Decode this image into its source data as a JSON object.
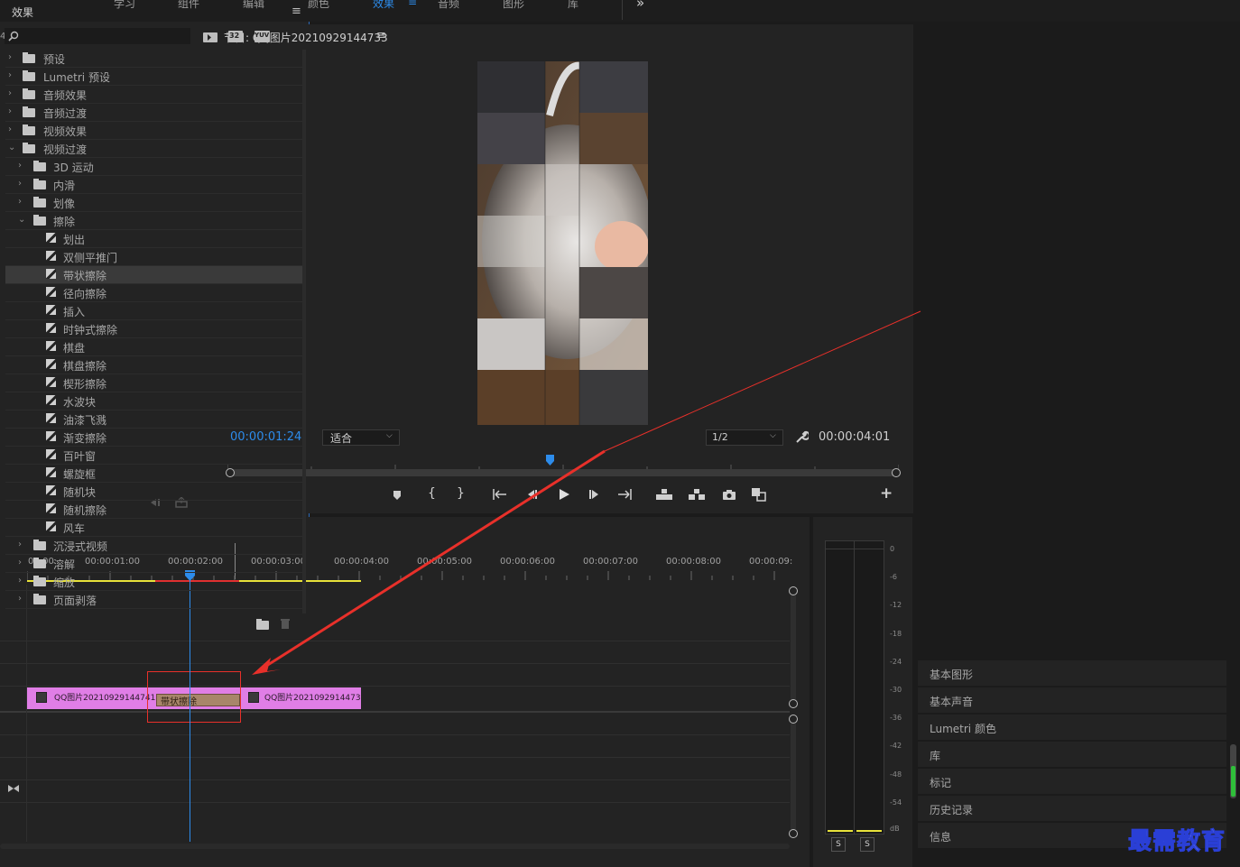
{
  "workspaces": [
    {
      "label": "学习",
      "active": false
    },
    {
      "label": "组件",
      "active": false
    },
    {
      "label": "编辑",
      "active": false
    },
    {
      "label": "颜色",
      "active": false
    },
    {
      "label": "效果",
      "active": true
    },
    {
      "label": "音频",
      "active": false
    },
    {
      "label": "图形",
      "active": false
    },
    {
      "label": "库",
      "active": false
    }
  ],
  "workspace_menu_glyph": "≡",
  "workspace_more_glyph": "»",
  "source_panel": {
    "partial_title": "4733"
  },
  "program": {
    "title": "节目: QQ图片20210929144733",
    "menu_glyph": "≡",
    "timecode_current": "00:00:01:24",
    "zoom_select": "适合",
    "resolution_select": "1/2",
    "timecode_duration": "00:00:04:01",
    "add_glyph": "+",
    "accent": "#2d8ceb"
  },
  "timeline": {
    "ruler": [
      "00:00",
      "00:00:01:00",
      "00:00:02:00",
      "00:00:03:00",
      "00:00:04:00",
      "00:00:05:00",
      "00:00:06:00",
      "00:00:07:00",
      "00:00:08:00",
      "00:00:09:"
    ],
    "clip_a": "QQ图片20210929144741",
    "clip_b": "QQ图片2021092914473",
    "transition": "带状擦除",
    "clip_color": "#e07ee6"
  },
  "meter": {
    "scale": [
      "0",
      "-6",
      "-12",
      "-18",
      "-24",
      "-30",
      "-36",
      "-42",
      "-48",
      "-54",
      "dB"
    ],
    "solo_left": "S",
    "solo_right": "S"
  },
  "effects": {
    "title": "效果",
    "menu_glyph": "≡",
    "search_placeholder": "",
    "filter_buttons": [
      "32",
      "YUV"
    ],
    "tree": [
      {
        "label": "预设",
        "level": 0,
        "kind": "preset",
        "state": "closed"
      },
      {
        "label": "Lumetri 预设",
        "level": 0,
        "kind": "preset",
        "state": "closed"
      },
      {
        "label": "音频效果",
        "level": 0,
        "kind": "folder",
        "state": "closed"
      },
      {
        "label": "音频过渡",
        "level": 0,
        "kind": "folder",
        "state": "closed"
      },
      {
        "label": "视频效果",
        "level": 0,
        "kind": "folder",
        "state": "closed"
      },
      {
        "label": "视频过渡",
        "level": 0,
        "kind": "folder",
        "state": "open"
      },
      {
        "label": "3D 运动",
        "level": 1,
        "kind": "folder",
        "state": "closed"
      },
      {
        "label": "内滑",
        "level": 1,
        "kind": "folder",
        "state": "closed"
      },
      {
        "label": "划像",
        "level": 1,
        "kind": "folder",
        "state": "closed"
      },
      {
        "label": "擦除",
        "level": 1,
        "kind": "folder",
        "state": "open"
      },
      {
        "label": "划出",
        "level": 2,
        "kind": "item"
      },
      {
        "label": "双侧平推门",
        "level": 2,
        "kind": "item"
      },
      {
        "label": "带状擦除",
        "level": 2,
        "kind": "item",
        "selected": true
      },
      {
        "label": "径向擦除",
        "level": 2,
        "kind": "item"
      },
      {
        "label": "插入",
        "level": 2,
        "kind": "item"
      },
      {
        "label": "时钟式擦除",
        "level": 2,
        "kind": "item"
      },
      {
        "label": "棋盘",
        "level": 2,
        "kind": "item"
      },
      {
        "label": "棋盘擦除",
        "level": 2,
        "kind": "item"
      },
      {
        "label": "楔形擦除",
        "level": 2,
        "kind": "item"
      },
      {
        "label": "水波块",
        "level": 2,
        "kind": "item"
      },
      {
        "label": "油漆飞溅",
        "level": 2,
        "kind": "item"
      },
      {
        "label": "渐变擦除",
        "level": 2,
        "kind": "item"
      },
      {
        "label": "百叶窗",
        "level": 2,
        "kind": "item"
      },
      {
        "label": "螺旋框",
        "level": 2,
        "kind": "item"
      },
      {
        "label": "随机块",
        "level": 2,
        "kind": "item"
      },
      {
        "label": "随机擦除",
        "level": 2,
        "kind": "item"
      },
      {
        "label": "风车",
        "level": 2,
        "kind": "item"
      },
      {
        "label": "沉浸式视频",
        "level": 1,
        "kind": "folder",
        "state": "closed"
      },
      {
        "label": "溶解",
        "level": 1,
        "kind": "folder",
        "state": "closed"
      },
      {
        "label": "缩放",
        "level": 1,
        "kind": "folder",
        "state": "closed"
      },
      {
        "label": "页面剥落",
        "level": 1,
        "kind": "folder",
        "state": "closed"
      }
    ]
  },
  "side_panels": [
    "基本图形",
    "基本声音",
    "Lumetri 颜色",
    "库",
    "标记",
    "历史记录",
    "信息"
  ],
  "watermark": "最需教育",
  "annotation_color": "#e8302a"
}
